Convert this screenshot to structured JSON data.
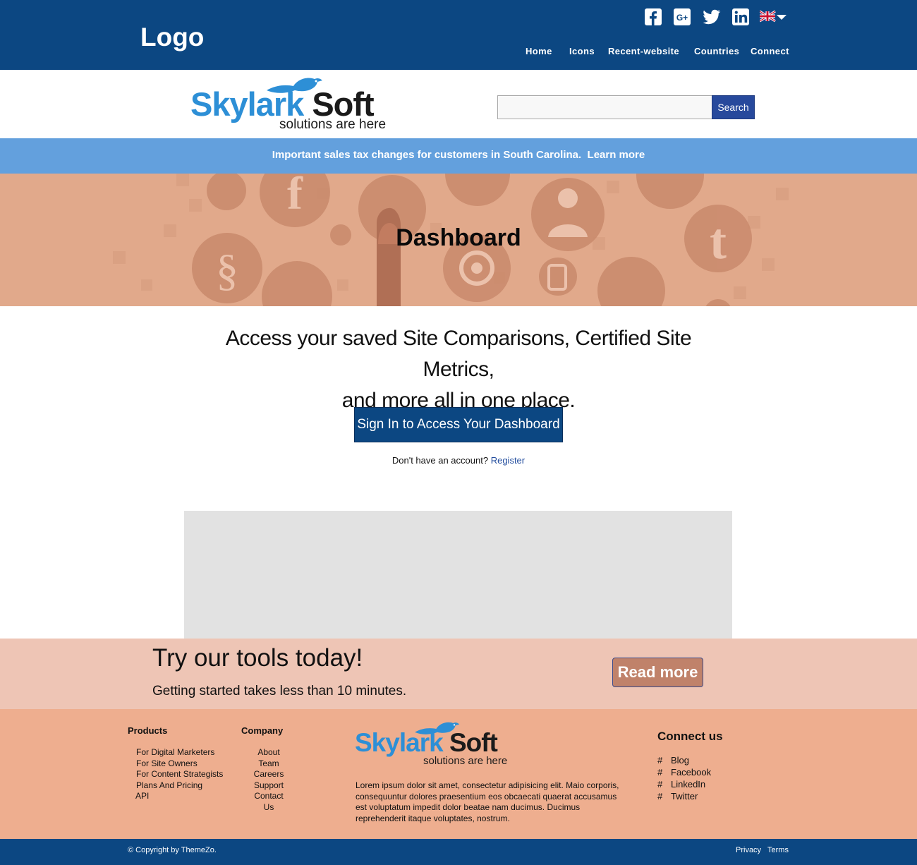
{
  "header": {
    "logo_text": "Logo",
    "social_icons": [
      "facebook-icon",
      "google-plus-icon",
      "twitter-icon",
      "linkedin-icon"
    ],
    "language_flag": "uk-flag-icon",
    "nav": [
      "Home",
      "Icons",
      "Recent-website",
      "Countries",
      "Connect"
    ]
  },
  "brand": {
    "name_part1": "Skylark",
    "name_part2": "Soft",
    "tagline": "solutions are here"
  },
  "search": {
    "placeholder": "",
    "button_label": "Search"
  },
  "notice": {
    "text": "Important sales tax changes for customers in South Carolina.",
    "link": "Learn more"
  },
  "hero": {
    "title": "Dashboard"
  },
  "main": {
    "lead_line1": "Access your saved Site Comparisons, Certified Site Metrics,",
    "lead_line2": "and more all in one place.",
    "signin_label": "Sign In to Access Your Dashboard",
    "no_account_text": "Don't have an account?",
    "register_link": "Register"
  },
  "cta": {
    "title": "Try our tools today!",
    "subtitle": "Getting started takes less than 10 minutes.",
    "button": "Read more"
  },
  "footer": {
    "products_heading": "Products",
    "products": [
      "For Digital Marketers",
      "For Site Owners",
      "For Content Strategists",
      "Plans And Pricing",
      "API"
    ],
    "company_heading": "Company",
    "company": [
      "About",
      "Team",
      "Careers",
      "Support",
      "Contact Us"
    ],
    "description": "Lorem ipsum dolor sit amet, consectetur adipisicing elit. Maio corporis, consequuntur dolores praesentium eos obcaecati  quaerat accusamus est voluptatum impedit dolor beatae nam ducimus. Ducimus reprehenderit itaque voluptates, nostrum.",
    "connect_heading": "Connect us",
    "connect_hash": "#",
    "connect": [
      "Blog",
      "Facebook",
      "LinkedIn",
      "Twitter"
    ],
    "copyright": "©  Copyright by  ThemeZo.",
    "privacy": "Privacy",
    "terms": "Terms"
  },
  "colors": {
    "header_bg": "#0c4782",
    "notice_bg": "#63a0dd",
    "hero_bg": "#e1a98b",
    "cta_bg": "#eec5b5",
    "footer_bg": "#eeae8f",
    "read_more_bg": "#c0826a",
    "search_button_bg": "#27499c",
    "brand_blue": "#2d8fd6"
  }
}
